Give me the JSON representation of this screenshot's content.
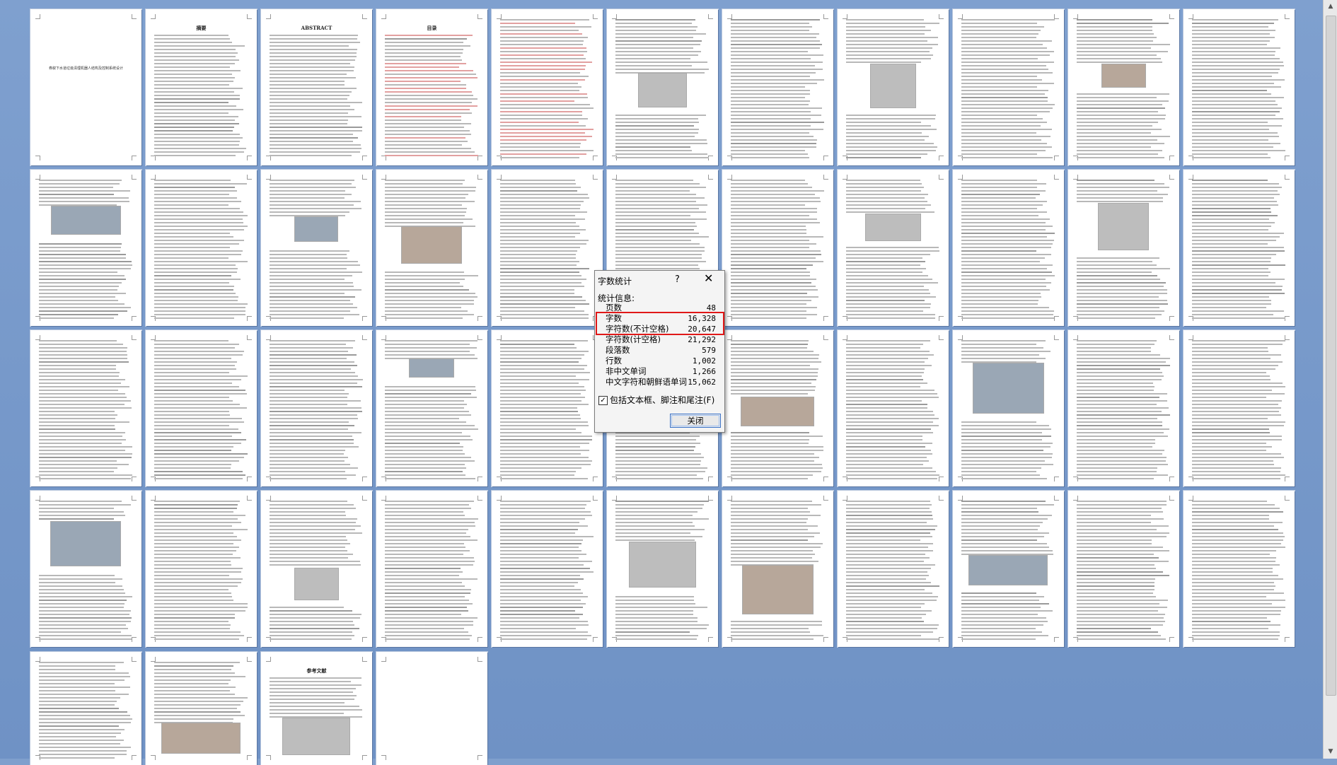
{
  "document": {
    "page_count": 48,
    "cover_title": "券叙下水道垃圾清理机器人结构及控制系统设计",
    "abstract_cn_heading": "摘要",
    "abstract_en_heading": "ABSTRACT",
    "toc_heading": "目录",
    "references_heading": "参考文献"
  },
  "dialog": {
    "title": "字数统计",
    "help_label": "?",
    "close_symbol": "✕",
    "section_label": "统计信息:",
    "stats": [
      {
        "label": "页数",
        "value": "48"
      },
      {
        "label": "字数",
        "value": "16,328"
      },
      {
        "label": "字符数(不计空格)",
        "value": "20,647"
      },
      {
        "label": "字符数(计空格)",
        "value": "21,292"
      },
      {
        "label": "段落数",
        "value": "579"
      },
      {
        "label": "行数",
        "value": "1,002"
      },
      {
        "label": "非中文单词",
        "value": "1,266"
      },
      {
        "label": "中文字符和朝鲜语单词",
        "value": "15,062"
      }
    ],
    "checkbox_label": "包括文本框、脚注和尾注(F)",
    "checkbox_checked": true,
    "checkbox_mark": "✓",
    "close_button_label": "关闭"
  },
  "scrollbar": {
    "up_icon": "▲",
    "down_icon": "▼"
  },
  "colors": {
    "highlight": "#e01818",
    "workspace": "#7f9fcd"
  }
}
